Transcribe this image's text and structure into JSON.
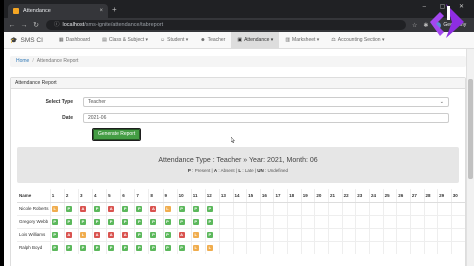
{
  "browser": {
    "tab_title": "Attendance",
    "url_host": "localhost",
    "url_path": "/sms-ignite/attendance/tabreport",
    "profile_name": "Geovanny"
  },
  "navbar": {
    "brand": "SMS CI",
    "items": [
      {
        "label": "Dashboard",
        "icon": "dashboard-icon"
      },
      {
        "label": "Class & Subject",
        "icon": "book-icon",
        "caret": true
      },
      {
        "label": "Student",
        "icon": "user-icon",
        "caret": true
      },
      {
        "label": "Teacher",
        "icon": "teacher-icon"
      },
      {
        "label": "Attendance",
        "icon": "calendar-icon",
        "caret": true,
        "active": true
      },
      {
        "label": "Marksheet",
        "icon": "marksheet-icon",
        "caret": true
      },
      {
        "label": "Accounting Section",
        "icon": "accounting-icon",
        "caret": true
      }
    ]
  },
  "breadcrumb": {
    "home": "Home",
    "current": "Attendance Report"
  },
  "panel": {
    "title": "Attendance Report"
  },
  "form": {
    "type_label": "Select Type",
    "type_value": "Teacher",
    "date_label": "Date",
    "date_value": "2021-06",
    "generate_label": "Generate Report"
  },
  "report": {
    "title": "Attendance Type : Teacher » Year: 2021, Month: 06",
    "legend": [
      {
        "code": "P",
        "text": "Present"
      },
      {
        "code": "A",
        "text": "Absent"
      },
      {
        "code": "L",
        "text": "Late"
      },
      {
        "code": "UN",
        "text": "Undefined"
      }
    ]
  },
  "table": {
    "name_header": "Name",
    "days": [
      "1",
      "2",
      "3",
      "4",
      "5",
      "6",
      "7",
      "8",
      "9",
      "10",
      "11",
      "12",
      "13",
      "14",
      "15",
      "16",
      "17",
      "18",
      "19",
      "20",
      "21",
      "22",
      "23",
      "24",
      "25",
      "26",
      "27",
      "28",
      "29",
      "30"
    ],
    "rows": [
      {
        "name": "Nicole Roberts",
        "marks": [
          "L",
          "P",
          "A",
          "P",
          "A",
          "P",
          "P",
          "A",
          "L",
          "P",
          "P",
          "P",
          "",
          "",
          "",
          "",
          "",
          "",
          "",
          "",
          "",
          "",
          "",
          "",
          "",
          "",
          "",
          "",
          "",
          ""
        ]
      },
      {
        "name": "Gregory Webb",
        "marks": [
          "P",
          "P",
          "P",
          "P",
          "P",
          "P",
          "P",
          "P",
          "P",
          "P",
          "P",
          "P",
          "",
          "",
          "",
          "",
          "",
          "",
          "",
          "",
          "",
          "",
          "",
          "",
          "",
          "",
          "",
          "",
          "",
          ""
        ]
      },
      {
        "name": "Lois Williams",
        "marks": [
          "P",
          "A",
          "L",
          "A",
          "A",
          "A",
          "P",
          "P",
          "P",
          "A",
          "L",
          "P",
          "",
          "",
          "",
          "",
          "",
          "",
          "",
          "",
          "",
          "",
          "",
          "",
          "",
          "",
          "",
          "",
          "",
          ""
        ]
      },
      {
        "name": "Ralph Boyd",
        "marks": [
          "P",
          "P",
          "P",
          "P",
          "P",
          "P",
          "P",
          "P",
          "P",
          "P",
          "L",
          "L",
          "",
          "",
          "",
          "",
          "",
          "",
          "",
          "",
          "",
          "",
          "",
          "",
          "",
          "",
          "",
          "",
          "",
          ""
        ]
      }
    ]
  },
  "colors": {
    "present": "#5cb85c",
    "absent": "#d9534f",
    "late": "#f0ad4e",
    "generate_button": "#449d44",
    "logo_purple": "#8e2de2"
  }
}
